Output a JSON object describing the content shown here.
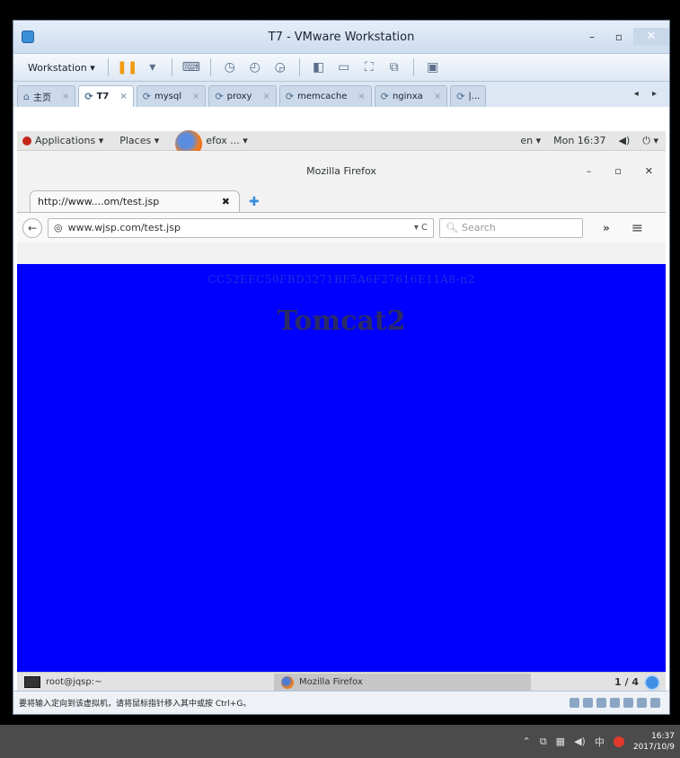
{
  "vm": {
    "title": "T7 - VMware Workstation",
    "minimize": "–",
    "maximize": "▫",
    "close": "✕",
    "toolbar": {
      "workstation_menu": "Workstation ▾"
    },
    "tabs": [
      {
        "label": "主页",
        "icon": "home-icon",
        "active": false
      },
      {
        "label": "T7",
        "icon": "vm-icon",
        "active": true
      },
      {
        "label": "mysql",
        "icon": "vm-icon",
        "active": false
      },
      {
        "label": "proxy",
        "icon": "vm-icon",
        "active": false
      },
      {
        "label": "memcache",
        "icon": "vm-icon",
        "active": false
      },
      {
        "label": "nginxa",
        "icon": "vm-icon",
        "active": false
      },
      {
        "label": "|...",
        "icon": "vm-icon",
        "active": false
      }
    ],
    "tab_close": "×",
    "tab_scroll": "◂ ▸",
    "statusbar_text": "要将输入定向到该虚拟机，请将鼠标指针移入其中或按 Ctrl+G。"
  },
  "gnome": {
    "applications": "Applications ▾",
    "places": "Places ▾",
    "firefox_app": "efox ... ▾",
    "lang": "en ▾",
    "clock": "Mon 16:37",
    "volume": "◀)",
    "power": "⏻ ▾"
  },
  "firefox": {
    "window_title": "Mozilla Firefox",
    "tab_title": "http://www....om/test.jsp",
    "tab_close": "✖",
    "new_tab": "✚",
    "url": "www.wjsp.com/test.jsp",
    "url_tools": "▾ C",
    "search_placeholder": "Search",
    "overflow": "»",
    "menu": "≡"
  },
  "page": {
    "session_id": "CC52EFC50FBD3271BF5A6F27616E11A8-n2",
    "heading": "Tomcat2"
  },
  "guest_taskbar": {
    "terminal": "root@jqsp:~",
    "firefox": "Mozilla Firefox",
    "workspace": "1 / 4"
  },
  "host": {
    "time": "16:37",
    "date": "2017/10/9",
    "tray_ime": "中"
  }
}
